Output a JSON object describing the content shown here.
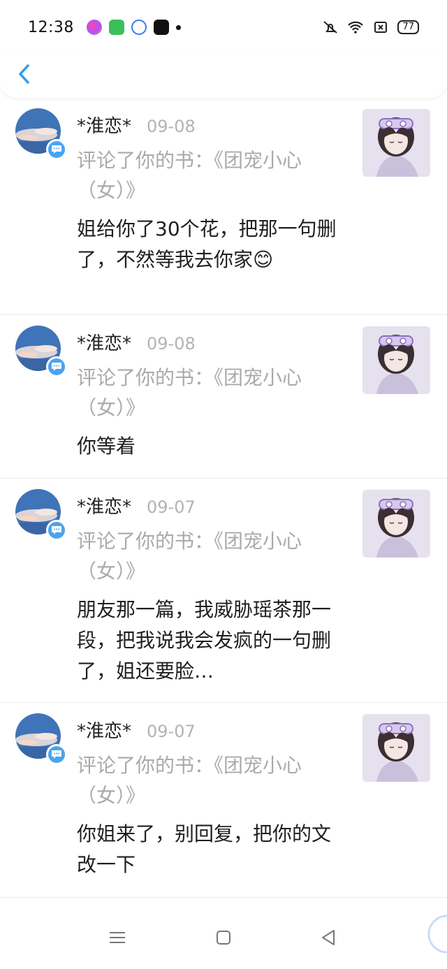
{
  "status_bar": {
    "time": "12:38",
    "battery": "77",
    "icons": [
      "colorful-app-icon",
      "green-app-icon",
      "baidu-icon",
      "douyin-icon",
      "notification-dot",
      "mute-icon",
      "wifi-icon",
      "sim-icon",
      "battery-icon"
    ]
  },
  "header": {
    "back_icon": "chevron-left-icon",
    "accent": "#2f9bf0"
  },
  "items": [
    {
      "name": "*淮恋*",
      "date": "09-08",
      "sub": "评论了你的书：《团宠小心（女）》",
      "message": "姐给你了30个花，把那一句删了，不然等我去你家😊"
    },
    {
      "name": "*淮恋*",
      "date": "09-08",
      "sub": "评论了你的书：《团宠小心（女）》",
      "message": "你等着"
    },
    {
      "name": "*淮恋*",
      "date": "09-07",
      "sub": "评论了你的书：《团宠小心（女）》",
      "message": "朋友那一篇，我威胁瑶茶那一段，把我说我会发疯的一句删了，姐还要脸…"
    },
    {
      "name": "*淮恋*",
      "date": "09-07",
      "sub": "评论了你的书：《团宠小心（女）》",
      "message": "你姐来了，别回复，把你的文改一下"
    }
  ],
  "nav": {
    "icons": [
      "menu-icon",
      "home-square-icon",
      "back-triangle-icon"
    ]
  }
}
